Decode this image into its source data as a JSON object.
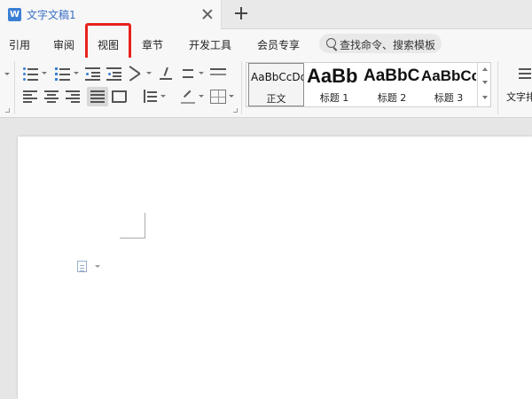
{
  "titlebar": {
    "app_icon_glyph": "W",
    "doc_title": "文字文稿1",
    "close_icon": "close-icon",
    "new_tab_icon": "plus-icon"
  },
  "menubar": {
    "items": [
      "引用",
      "审阅",
      "视图",
      "章节",
      "开发工具",
      "会员专享"
    ],
    "highlighted_item": "视图",
    "highlight_color": "#e8221c",
    "search_placeholder": "查找命令、搜索模板"
  },
  "ribbon": {
    "styles": [
      {
        "sample": "AaBbCcDd",
        "name": "正文"
      },
      {
        "sample": "AaBb",
        "name": "标题 1"
      },
      {
        "sample": "AaBbC",
        "name": "标题 2"
      },
      {
        "sample": "AaBbCc",
        "name": "标题 3"
      }
    ],
    "text_tools_label": "文字排"
  },
  "colors": {
    "accent": "#3a7fd5",
    "page": "#ffffff",
    "canvas": "#e6e6e6"
  }
}
